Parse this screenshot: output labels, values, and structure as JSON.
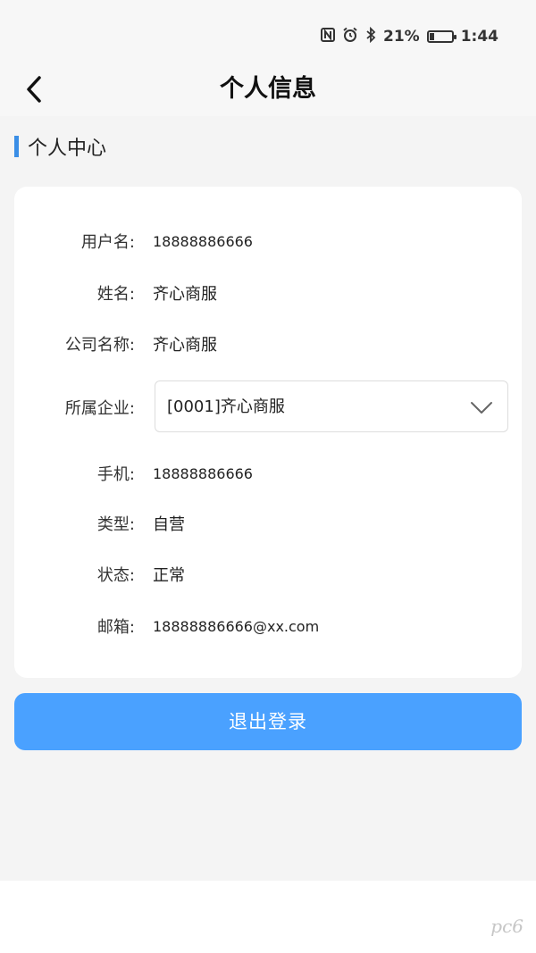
{
  "status_bar": {
    "battery": "21%",
    "battery_level": 0.21,
    "time": "1:44",
    "icons": [
      "nfc-icon",
      "alarm-icon",
      "bluetooth-icon",
      "battery-icon"
    ]
  },
  "header": {
    "title": "个人信息",
    "back_icon": "chevron-left-icon"
  },
  "section": {
    "title": "个人中心",
    "accent": "#3a8ee6"
  },
  "profile": {
    "username_label": "用户名:",
    "username": "18888886666",
    "name_label": "姓名:",
    "name": "齐心商服",
    "company_label": "公司名称:",
    "company": "齐心商服",
    "enterprise_label": "所属企业:",
    "enterprise": "[0001]齐心商服",
    "phone_label": "手机:",
    "phone": "18888886666",
    "type_label": "类型:",
    "type": "自营",
    "status_label": "状态:",
    "status": "正常",
    "email_label": "邮箱:",
    "email": "18888886666@xx.com"
  },
  "actions": {
    "logout": "退出登录",
    "logout_color": "#4aa1ff"
  },
  "watermark": "pc6"
}
